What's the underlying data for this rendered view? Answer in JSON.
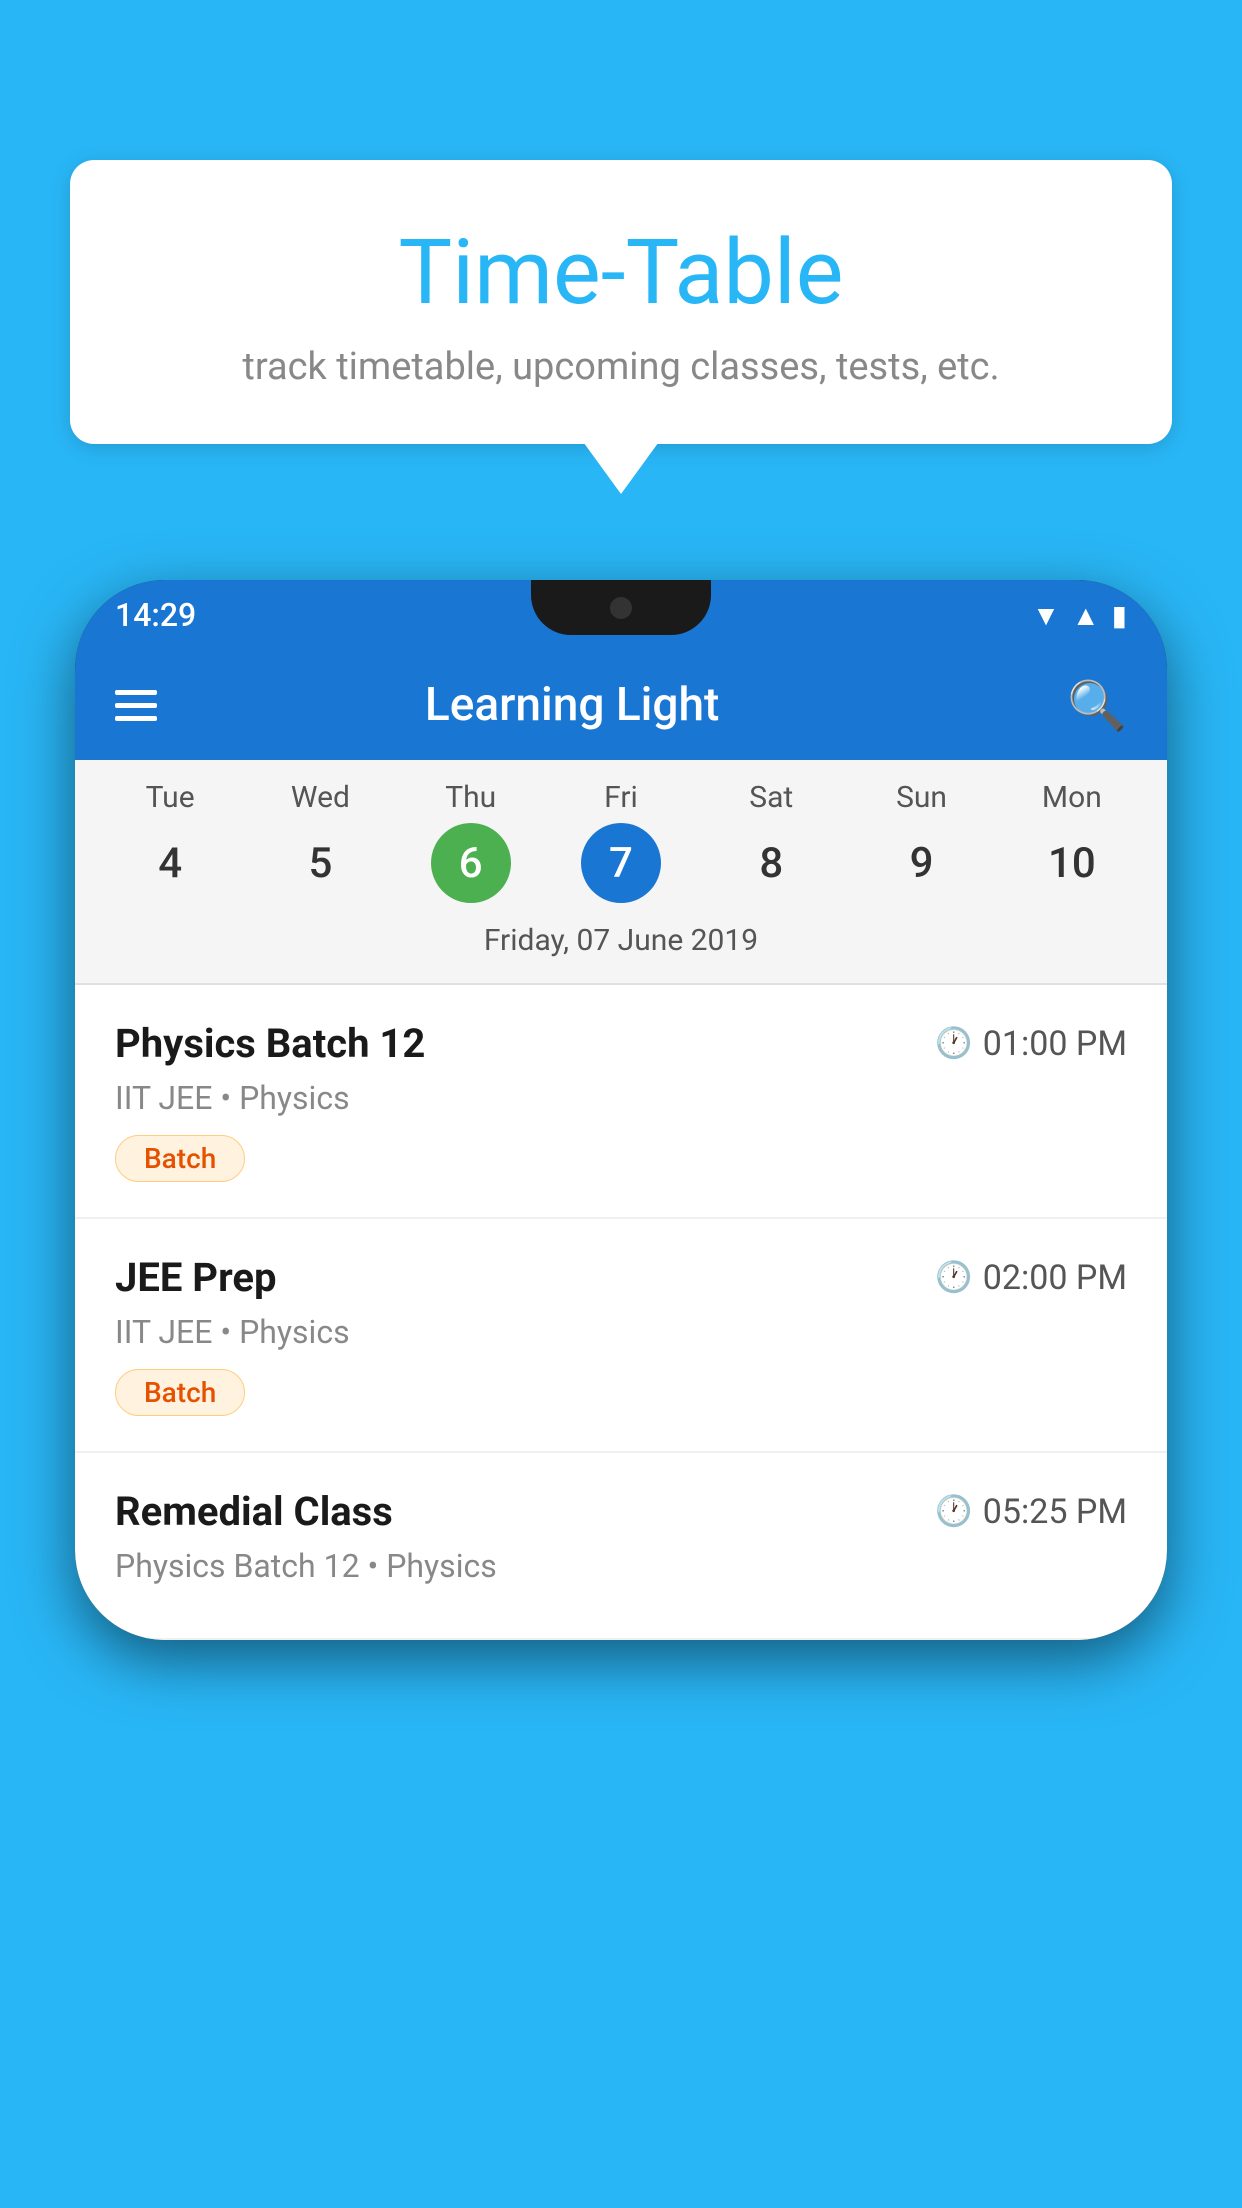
{
  "background_color": "#29B6F6",
  "bubble": {
    "title": "Time-Table",
    "subtitle": "track timetable, upcoming classes, tests, etc."
  },
  "status_bar": {
    "time": "14:29"
  },
  "app_bar": {
    "title": "Learning Light"
  },
  "calendar": {
    "days": [
      {
        "name": "Tue",
        "number": "4",
        "state": "normal"
      },
      {
        "name": "Wed",
        "number": "5",
        "state": "normal"
      },
      {
        "name": "Thu",
        "number": "6",
        "state": "today"
      },
      {
        "name": "Fri",
        "number": "7",
        "state": "selected"
      },
      {
        "name": "Sat",
        "number": "8",
        "state": "normal"
      },
      {
        "name": "Sun",
        "number": "9",
        "state": "normal"
      },
      {
        "name": "Mon",
        "number": "10",
        "state": "normal"
      }
    ],
    "selected_date_label": "Friday, 07 June 2019"
  },
  "schedule": {
    "items": [
      {
        "title": "Physics Batch 12",
        "time": "01:00 PM",
        "subtitle": "IIT JEE • Physics",
        "tag": "Batch"
      },
      {
        "title": "JEE Prep",
        "time": "02:00 PM",
        "subtitle": "IIT JEE • Physics",
        "tag": "Batch"
      },
      {
        "title": "Remedial Class",
        "time": "05:25 PM",
        "subtitle": "Physics Batch 12 • Physics",
        "tag": ""
      }
    ]
  }
}
